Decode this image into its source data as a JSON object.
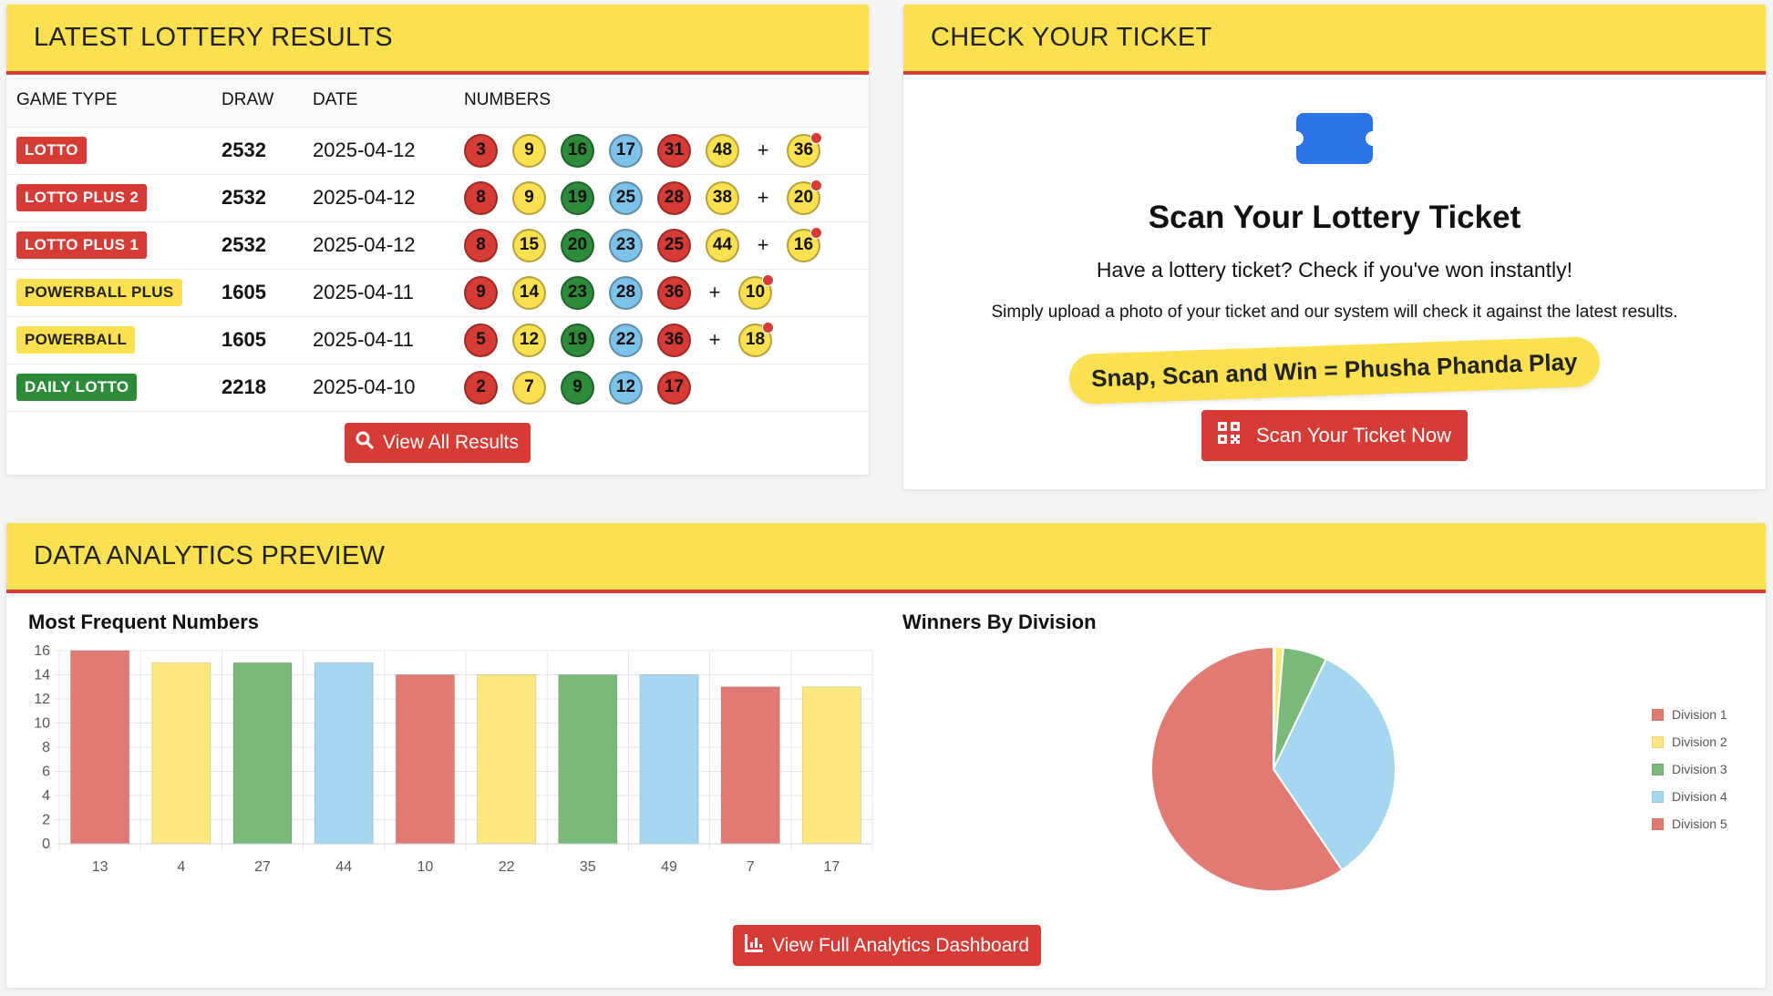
{
  "results": {
    "title": "LATEST LOTTERY RESULTS",
    "columns": [
      "GAME TYPE",
      "DRAW",
      "DATE",
      "NUMBERS"
    ],
    "rows": [
      {
        "game": "LOTTO",
        "badge": "red",
        "draw": "2532",
        "date": "2025-04-12",
        "balls": [
          {
            "n": "3",
            "c": "red"
          },
          {
            "n": "9",
            "c": "yellow"
          },
          {
            "n": "16",
            "c": "green"
          },
          {
            "n": "17",
            "c": "blue"
          },
          {
            "n": "31",
            "c": "red"
          },
          {
            "n": "48",
            "c": "yellow"
          }
        ],
        "bonus": {
          "n": "36",
          "c": "yellow"
        }
      },
      {
        "game": "LOTTO PLUS 2",
        "badge": "red",
        "draw": "2532",
        "date": "2025-04-12",
        "balls": [
          {
            "n": "8",
            "c": "red"
          },
          {
            "n": "9",
            "c": "yellow"
          },
          {
            "n": "19",
            "c": "green"
          },
          {
            "n": "25",
            "c": "blue"
          },
          {
            "n": "28",
            "c": "red"
          },
          {
            "n": "38",
            "c": "yellow"
          }
        ],
        "bonus": {
          "n": "20",
          "c": "yellow"
        }
      },
      {
        "game": "LOTTO PLUS 1",
        "badge": "red",
        "draw": "2532",
        "date": "2025-04-12",
        "balls": [
          {
            "n": "8",
            "c": "red"
          },
          {
            "n": "15",
            "c": "yellow"
          },
          {
            "n": "20",
            "c": "green"
          },
          {
            "n": "23",
            "c": "blue"
          },
          {
            "n": "25",
            "c": "red"
          },
          {
            "n": "44",
            "c": "yellow"
          }
        ],
        "bonus": {
          "n": "16",
          "c": "yellow"
        }
      },
      {
        "game": "POWERBALL PLUS",
        "badge": "yellow",
        "draw": "1605",
        "date": "2025-04-11",
        "balls": [
          {
            "n": "9",
            "c": "red"
          },
          {
            "n": "14",
            "c": "yellow"
          },
          {
            "n": "23",
            "c": "green"
          },
          {
            "n": "28",
            "c": "blue"
          },
          {
            "n": "36",
            "c": "red"
          }
        ],
        "bonus": {
          "n": "10",
          "c": "yellow"
        }
      },
      {
        "game": "POWERBALL",
        "badge": "yellow",
        "draw": "1605",
        "date": "2025-04-11",
        "balls": [
          {
            "n": "5",
            "c": "red"
          },
          {
            "n": "12",
            "c": "yellow"
          },
          {
            "n": "19",
            "c": "green"
          },
          {
            "n": "22",
            "c": "blue"
          },
          {
            "n": "36",
            "c": "red"
          }
        ],
        "bonus": {
          "n": "18",
          "c": "yellow"
        }
      },
      {
        "game": "DAILY LOTTO",
        "badge": "green",
        "draw": "2218",
        "date": "2025-04-10",
        "balls": [
          {
            "n": "2",
            "c": "red"
          },
          {
            "n": "7",
            "c": "yellow"
          },
          {
            "n": "9",
            "c": "green"
          },
          {
            "n": "12",
            "c": "blue"
          },
          {
            "n": "17",
            "c": "red"
          }
        ],
        "bonus": null
      }
    ],
    "plus_sign": "+",
    "view_all_label": "View All Results",
    "view_all_icon": "search-icon"
  },
  "check": {
    "title": "CHECK YOUR TICKET",
    "icon": "ticket-icon",
    "heading": "Scan Your Lottery Ticket",
    "subtitle": "Have a lottery ticket? Check if you've won instantly!",
    "description": "Simply upload a photo of your ticket and our system will check it against the latest results.",
    "slogan": "Snap, Scan and Win = Phusha Phanda Play",
    "button_label": "Scan Your Ticket Now",
    "button_icon": "qrcode-icon"
  },
  "analytics": {
    "title": "DATA ANALYTICS PREVIEW",
    "button_label": "View Full Analytics Dashboard",
    "button_icon": "chart-bar-icon"
  },
  "colors": {
    "red": "#d63b35",
    "yellow": "#fbe04f",
    "green": "#2e8b3a",
    "blue": "#7dc2e8",
    "ticket_blue": "#2a74e6"
  },
  "chart_data": [
    {
      "type": "bar",
      "title": "Most Frequent Numbers",
      "categories": [
        "13",
        "4",
        "27",
        "44",
        "10",
        "22",
        "35",
        "49",
        "7",
        "17"
      ],
      "values": [
        16,
        15,
        15,
        15,
        14,
        14,
        14,
        14,
        13,
        13
      ],
      "bar_colors": [
        "#e07a73",
        "#fbe67f",
        "#7ab97a",
        "#a5d6ef",
        "#e07a73",
        "#fbe67f",
        "#7ab97a",
        "#a5d6ef",
        "#e07a73",
        "#fbe67f"
      ],
      "ylim": [
        0,
        16
      ],
      "yticks": [
        0,
        2,
        4,
        6,
        8,
        10,
        12,
        14,
        16
      ],
      "grid": true,
      "xlabel": "",
      "ylabel": ""
    },
    {
      "type": "pie",
      "title": "Winners By Division",
      "labels": [
        "Division 1",
        "Division 2",
        "Division 3",
        "Division 4",
        "Division 5"
      ],
      "values": [
        0.2,
        1.1,
        5.8,
        33.4,
        59.5
      ],
      "colors": [
        "#e07a73",
        "#fbe67f",
        "#7ab97a",
        "#a5d6ef",
        "#e07a73"
      ],
      "legend": "right"
    }
  ]
}
